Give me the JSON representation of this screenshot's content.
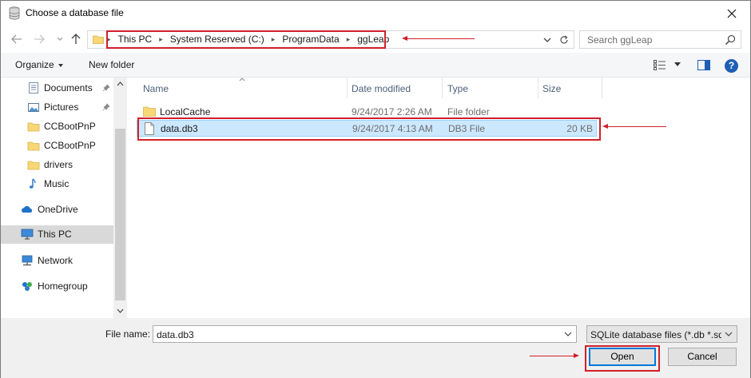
{
  "window": {
    "title": "Choose a database file",
    "close_icon": "close-icon",
    "title_icon": "database-icon"
  },
  "address": {
    "breadcrumbs": [
      "This PC",
      "System Reserved (C:)",
      "ProgramData",
      "ggLeap"
    ],
    "search_placeholder": "Search ggLeap"
  },
  "toolbar": {
    "organize_label": "Organize",
    "new_folder_label": "New folder"
  },
  "nav": {
    "items": [
      {
        "label": "Documents",
        "icon": "documents-icon",
        "pinned": true
      },
      {
        "label": "Pictures",
        "icon": "pictures-icon",
        "pinned": true
      },
      {
        "label": "CCBootPnP",
        "icon": "folder-icon",
        "pinned": false
      },
      {
        "label": "CCBootPnP",
        "icon": "folder-icon",
        "pinned": false
      },
      {
        "label": "drivers",
        "icon": "folder-icon",
        "pinned": false
      },
      {
        "label": "Music",
        "icon": "music-icon",
        "pinned": false
      },
      {
        "label": "OneDrive",
        "icon": "onedrive-icon",
        "pinned": false
      },
      {
        "label": "This PC",
        "icon": "computer-icon",
        "pinned": false,
        "selected": true
      },
      {
        "label": "Network",
        "icon": "network-icon",
        "pinned": false
      },
      {
        "label": "Homegroup",
        "icon": "homegroup-icon",
        "pinned": false
      }
    ]
  },
  "files": {
    "columns": [
      "Name",
      "Date modified",
      "Type",
      "Size"
    ],
    "rows": [
      {
        "name": "LocalCache",
        "date": "9/24/2017 2:26 AM",
        "type": "File folder",
        "size": "",
        "icon": "folder-icon"
      },
      {
        "name": "data.db3",
        "date": "9/24/2017 4:13 AM",
        "type": "DB3 File",
        "size": "20 KB",
        "icon": "file-icon",
        "selected": true
      }
    ]
  },
  "bottom": {
    "filename_label": "File name:",
    "filename_value": "data.db3",
    "filetype_value": "SQLite database files (*.db *.sql",
    "open_label": "Open",
    "cancel_label": "Cancel"
  },
  "colors": {
    "annotation_red": "#d0202a",
    "selection_bg": "#cce8ff",
    "accent_blue": "#0078d7",
    "folder_yellow": "#f8d775"
  }
}
